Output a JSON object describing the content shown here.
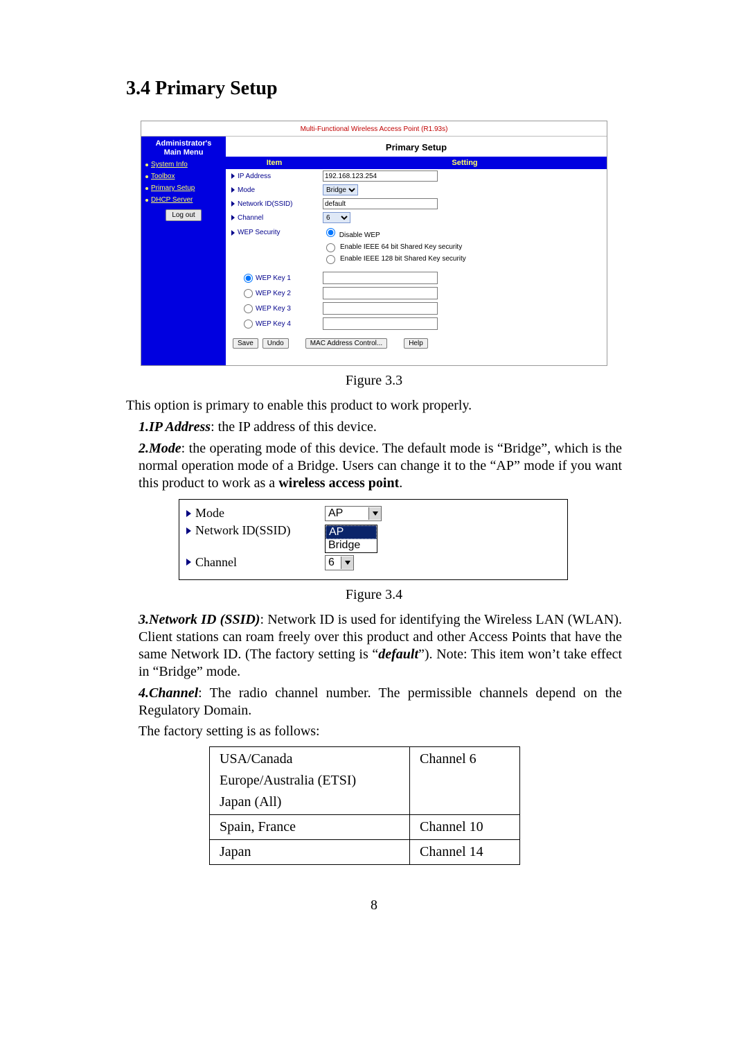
{
  "section_title": "3.4 Primary Setup",
  "router": {
    "banner": "Multi-Functional Wireless Access Point (R1.93s)",
    "side_title_l1": "Administrator's",
    "side_title_l2": "Main Menu",
    "side_links": [
      "System Info",
      "Toolbox",
      "Primary Setup",
      "DHCP Server"
    ],
    "logout": "Log out",
    "main_title": "Primary Setup",
    "hdr_item": "Item",
    "hdr_setting": "Setting",
    "rows": {
      "ip_label": "IP Address",
      "ip_value": "192.168.123.254",
      "mode_label": "Mode",
      "mode_value": "Bridge",
      "ssid_label": "Network ID(SSID)",
      "ssid_value": "default",
      "channel_label": "Channel",
      "channel_value": "6",
      "wep_label": "WEP Security",
      "wep_opts": [
        "Disable WEP",
        "Enable IEEE 64 bit Shared Key security",
        "Enable IEEE 128 bit Shared Key security"
      ],
      "wep_keys": [
        "WEP Key 1",
        "WEP Key 2",
        "WEP Key 3",
        "WEP Key 4"
      ]
    },
    "buttons": {
      "save": "Save",
      "undo": "Undo",
      "mac": "MAC Address Control...",
      "help": "Help"
    }
  },
  "fig33_caption": "Figure 3.3",
  "intro_para": "This option is primary to enable this product to work properly.",
  "item1_lead": "1.IP Address",
  "item1_rest": ": the IP address of this device.",
  "item2_lead": "2.Mode",
  "item2_rest": ": the operating mode of this device. The default mode is “Bridge”, which is the normal operation mode of a Bridge. Users can change it to the “AP” mode if you want this product to work as a ",
  "item2_bold_tail": "wireless access point",
  "fig34": {
    "mode_label": "Mode",
    "mode_selected": "AP",
    "mode_options": [
      "AP",
      "Bridge"
    ],
    "ssid_label": "Network ID(SSID)",
    "channel_label": "Channel",
    "channel_selected": "6"
  },
  "fig34_caption": "Figure 3.4",
  "item3_lead": "3.Network ID (SSID)",
  "item3_rest_a": ": Network ID is used for identifying the Wireless LAN (WLAN). Client stations can roam freely over this product and other Access Points that have the same Network ID. (The factory setting is “",
  "item3_default": "default",
  "item3_rest_b": "”). Note: This item won’t take effect in “Bridge” mode.",
  "item4_lead": "4.Channel",
  "item4_rest": ": The radio channel number. The permissible channels depend on the Regulatory Domain.",
  "item4_follow": "The factory setting is as follows:",
  "chan_table": {
    "r1_reg_l1": "USA/Canada",
    "r1_reg_l2": "Europe/Australia (ETSI)",
    "r1_reg_l3": "Japan (All)",
    "r1_ch": "Channel 6",
    "r2_reg": "Spain, France",
    "r2_ch": "Channel 10",
    "r3_reg": "Japan",
    "r3_ch": "Channel 14"
  },
  "page_number": "8"
}
